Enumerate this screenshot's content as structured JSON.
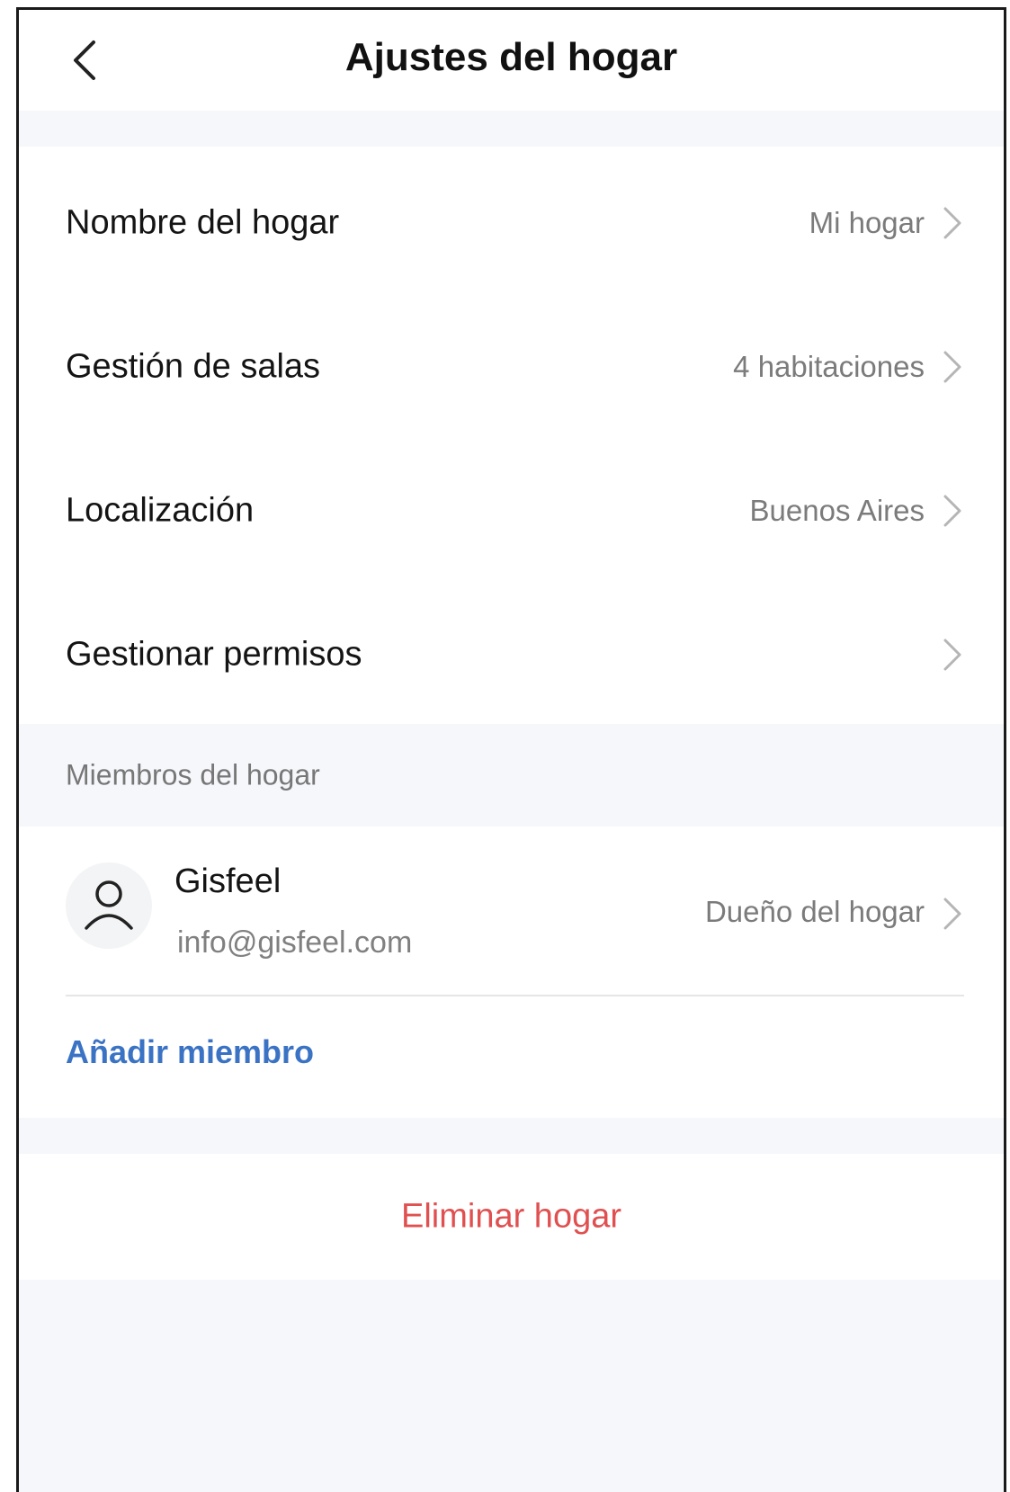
{
  "header": {
    "title": "Ajustes del hogar",
    "back_icon": "chevron-left-icon"
  },
  "settings": {
    "items": [
      {
        "label": "Nombre del hogar",
        "value": "Mi hogar"
      },
      {
        "label": "Gestión de salas",
        "value": "4 habitaciones"
      },
      {
        "label": "Localización",
        "value": "Buenos Aires"
      },
      {
        "label": "Gestionar permisos",
        "value": ""
      }
    ]
  },
  "members": {
    "section_title": "Miembros del hogar",
    "list": [
      {
        "name": "Gisfeel",
        "email": "info@gisfeel.com",
        "role": "Dueño del hogar",
        "icon": "user-icon"
      }
    ],
    "add_label": "Añadir miembro"
  },
  "danger": {
    "delete_label": "Eliminar hogar"
  },
  "colors": {
    "accent_blue": "#3b73c4",
    "danger_red": "#e05050",
    "background_gray": "#f6f7fb",
    "value_gray": "#7b7b7b"
  }
}
